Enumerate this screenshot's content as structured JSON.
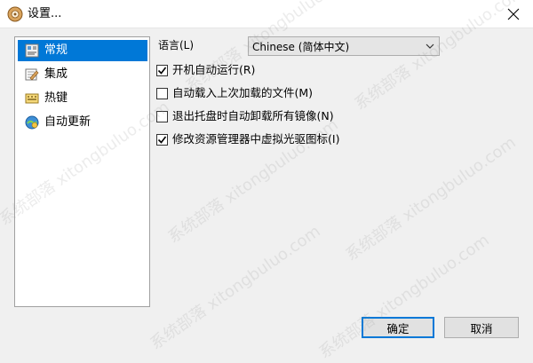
{
  "window": {
    "title": "设置...",
    "close_icon": "close-icon"
  },
  "sidebar": {
    "items": [
      {
        "label": "常规",
        "icon": "general-settings-icon",
        "selected": true
      },
      {
        "label": "集成",
        "icon": "integration-icon",
        "selected": false
      },
      {
        "label": "热键",
        "icon": "hotkey-icon",
        "selected": false
      },
      {
        "label": "自动更新",
        "icon": "auto-update-icon",
        "selected": false
      }
    ]
  },
  "general": {
    "language_label": "语言(L)",
    "language_value": "Chinese (简体中文)",
    "options": [
      {
        "label": "开机自动运行(R)",
        "checked": true
      },
      {
        "label": "自动载入上次加载的文件(M)",
        "checked": false
      },
      {
        "label": "退出托盘时自动卸载所有镜像(N)",
        "checked": false
      },
      {
        "label": "修改资源管理器中虚拟光驱图标(I)",
        "checked": true
      }
    ]
  },
  "footer": {
    "ok_label": "确定",
    "cancel_label": "取消"
  },
  "watermark_text": "系统部落 xitongbuluo.com",
  "colors": {
    "accent": "#0078d7",
    "window_bg": "#f0f0f0"
  }
}
